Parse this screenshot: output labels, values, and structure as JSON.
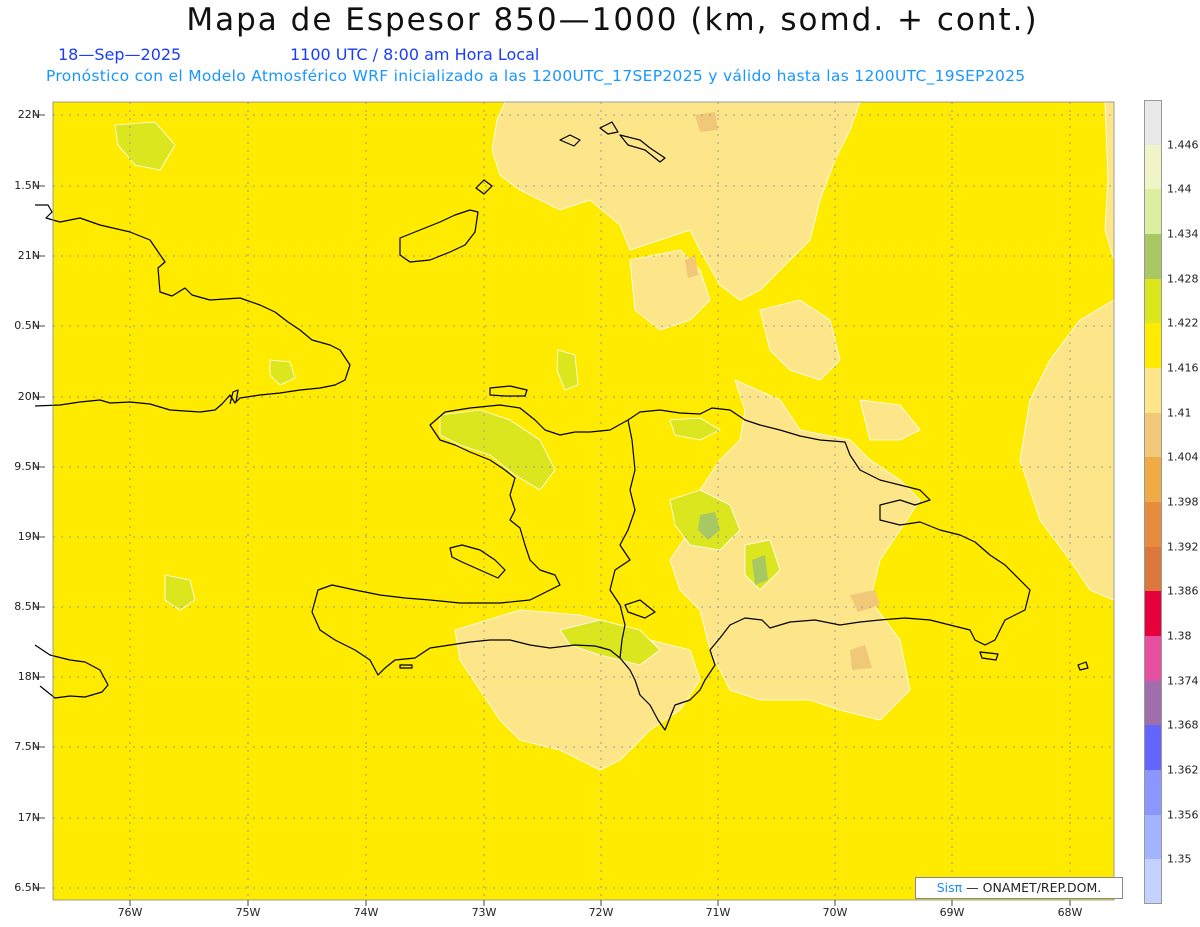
{
  "title": "Mapa de Espesor 850—1000 (km, somd. + cont.)",
  "date": "18—Sep—2025",
  "time": "1100 UTC / 8:00 am Hora Local",
  "forecast_line": "Pronóstico con el Modelo Atmosférico WRF inicializado a las 1200UTC_17SEP2025 y válido hasta las  1200UTC_19SEP2025",
  "lat_labels": [
    "22N",
    "1.5N",
    "21N",
    "0.5N",
    "20N",
    "9.5N",
    "19N",
    "8.5N",
    "18N",
    "7.5N",
    "17N",
    "6.5N"
  ],
  "lon_labels": [
    "76W",
    "75W",
    "74W",
    "73W",
    "72W",
    "71W",
    "70W",
    "69W",
    "68W"
  ],
  "colorbar": {
    "labels": [
      "1.446",
      "1.44",
      "1.434",
      "1.428",
      "1.422",
      "1.416",
      "1.41",
      "1.404",
      "1.398",
      "1.392",
      "1.386",
      "1.38",
      "1.374",
      "1.368",
      "1.362",
      "1.356",
      "1.35"
    ],
    "colors": [
      "#e8e8e8",
      "#f0f5c8",
      "#dcefa0",
      "#a8c864",
      "#dce61e",
      "#ffeb00",
      "#fde68a",
      "#f0c878",
      "#f0aa46",
      "#e68c3c",
      "#dc783c",
      "#e6003c",
      "#e650a0",
      "#a06eaa",
      "#6464ff",
      "#8c96ff",
      "#a0b4ff",
      "#c3d2ff"
    ]
  },
  "credit": {
    "sis": "Sisπ",
    "org": "— ONAMET/REP.DOM."
  },
  "colors": {
    "field": "#ffeb00",
    "light_field": "#fde68a",
    "green_field": "#dce61e"
  }
}
